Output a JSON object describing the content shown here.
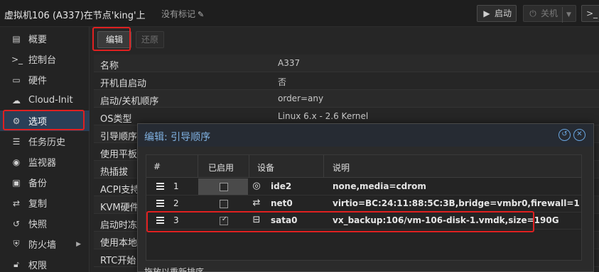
{
  "header": {
    "vm_title": "虚拟机106 (A337)在节点'king'上",
    "tags_label": "没有标记",
    "start_label": "启动",
    "shutdown_label": "关机",
    "console_label": ">_"
  },
  "sidebar": {
    "items": [
      {
        "label": "概要",
        "icon": "book-icon"
      },
      {
        "label": "控制台",
        "icon": "terminal-icon"
      },
      {
        "label": "硬件",
        "icon": "monitor-icon"
      },
      {
        "label": "Cloud-Init",
        "icon": "cloud-icon"
      },
      {
        "label": "选项",
        "icon": "gear-icon"
      },
      {
        "label": "任务历史",
        "icon": "list-icon"
      },
      {
        "label": "监视器",
        "icon": "eye-icon"
      },
      {
        "label": "备份",
        "icon": "floppy-icon"
      },
      {
        "label": "复制",
        "icon": "retweet-icon"
      },
      {
        "label": "快照",
        "icon": "history-icon"
      },
      {
        "label": "防火墙",
        "icon": "shield-icon"
      },
      {
        "label": "权限",
        "icon": "unlock-icon"
      }
    ]
  },
  "toolbar": {
    "edit_label": "编辑",
    "revert_label": "还原"
  },
  "options": [
    {
      "key": "名称",
      "value": "A337"
    },
    {
      "key": "开机自启动",
      "value": "否"
    },
    {
      "key": "启动/关机顺序",
      "value": "order=any"
    },
    {
      "key": "OS类型",
      "value": "Linux 6.x - 2.6 Kernel"
    },
    {
      "key": "引导顺序",
      "value": ""
    },
    {
      "key": "使用平板",
      "value": ""
    },
    {
      "key": "热插拔",
      "value": ""
    },
    {
      "key": "ACPI支持",
      "value": ""
    },
    {
      "key": "KVM硬件",
      "value": ""
    },
    {
      "key": "启动时冻结",
      "value": ""
    },
    {
      "key": "使用本地",
      "value": ""
    },
    {
      "key": "RTC开始",
      "value": ""
    }
  ],
  "modal": {
    "title": "编辑: 引导顺序",
    "columns": [
      "#",
      "已启用",
      "设备",
      "说明"
    ],
    "rows": [
      {
        "num": "1",
        "enabled": false,
        "device_icon": "cdrom-icon",
        "device": "ide2",
        "desc": "none,media=cdrom"
      },
      {
        "num": "2",
        "enabled": false,
        "device_icon": "exchange-icon",
        "device": "net0",
        "desc": "virtio=BC:24:11:88:5C:3B,bridge=vmbr0,firewall=1"
      },
      {
        "num": "3",
        "enabled": true,
        "device_icon": "hdd-icon",
        "device": "sata0",
        "desc": "vx_backup:106/vm-106-disk-1.vmdk,size=190G"
      }
    ],
    "footer_note": "拖放以重新排序"
  },
  "colors": {
    "highlight": "#e02020",
    "active_nav": "#2b3f57",
    "modal_title": "#7fb0e0"
  }
}
